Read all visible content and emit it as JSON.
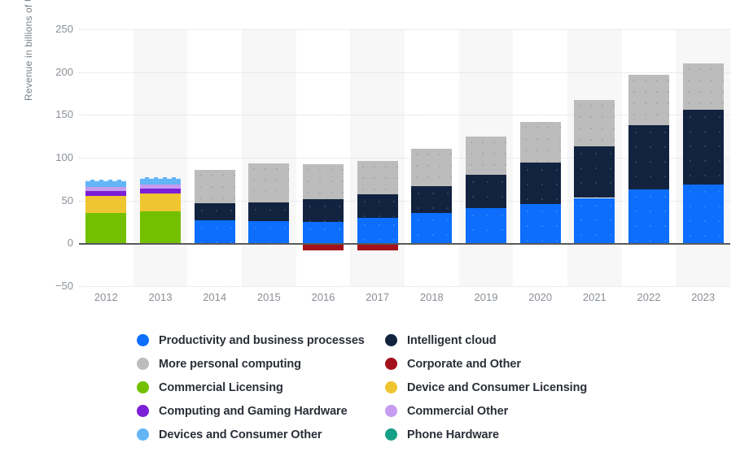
{
  "chart_data": {
    "type": "bar",
    "stacked": true,
    "title": "",
    "xlabel": "",
    "ylabel": "Revenue in billions of U.S. dollars",
    "categories": [
      "2012",
      "2013",
      "2014",
      "2015",
      "2016",
      "2017",
      "2018",
      "2019",
      "2020",
      "2021",
      "2022",
      "2023"
    ],
    "ylim": [
      -50,
      250
    ],
    "yticks": [
      -50,
      0,
      50,
      100,
      150,
      200,
      250
    ],
    "grid": true,
    "legend_position": "bottom",
    "series": [
      {
        "name": "Productivity and business processes",
        "color": "#0d6efd",
        "values": [
          null,
          null,
          27,
          26,
          25,
          30,
          35,
          41,
          46,
          53,
          63,
          69
        ]
      },
      {
        "name": "Intelligent cloud",
        "color": "#122340",
        "values": [
          null,
          null,
          20,
          22,
          27,
          27,
          32,
          39,
          48,
          60,
          75,
          87
        ]
      },
      {
        "name": "More personal computing",
        "color": "#bcbcbc",
        "values": [
          null,
          null,
          39,
          45,
          40,
          39,
          43,
          45,
          48,
          54,
          59,
          54
        ]
      },
      {
        "name": "Corporate and Other",
        "color": "#a5111a",
        "values": [
          null,
          null,
          null,
          null,
          -8,
          -8,
          null,
          null,
          null,
          null,
          null,
          null
        ]
      },
      {
        "name": "Commercial Licensing",
        "color": "#72c000",
        "values": [
          37,
          39,
          null,
          null,
          null,
          null,
          null,
          null,
          null,
          null,
          null,
          null
        ]
      },
      {
        "name": "Device and Consumer Licensing",
        "color": "#efc531",
        "values": [
          20,
          21,
          null,
          null,
          null,
          null,
          null,
          null,
          null,
          null,
          null,
          null
        ]
      },
      {
        "name": "Computing and Gaming Hardware",
        "color": "#7b1fd8",
        "values": [
          6,
          6,
          null,
          null,
          null,
          null,
          null,
          null,
          null,
          null,
          null,
          null
        ]
      },
      {
        "name": "Commercial Other",
        "color": "#c79bf0",
        "values": [
          5,
          5,
          null,
          null,
          null,
          null,
          null,
          null,
          null,
          null,
          null,
          null
        ]
      },
      {
        "name": "Devices and Consumer Other",
        "color": "#64b5f6",
        "values": [
          6,
          6,
          null,
          null,
          null,
          null,
          null,
          null,
          null,
          null,
          null,
          null
        ]
      },
      {
        "name": "Phone Hardware",
        "color": "#16a085",
        "values": [
          null,
          null,
          null,
          null,
          null,
          null,
          null,
          null,
          null,
          null,
          null,
          null
        ]
      }
    ],
    "totals": [
      74,
      77,
      86,
      93,
      92,
      96,
      110,
      125,
      142,
      167,
      197,
      210
    ]
  },
  "axis": {
    "y_title": "Revenue in billions of U.S. dollars",
    "y_ticks": [
      "250",
      "200",
      "150",
      "100",
      "50",
      "0",
      "−50"
    ],
    "x_ticks": [
      "2012",
      "2013",
      "2014",
      "2015",
      "2016",
      "2017",
      "2018",
      "2019",
      "2020",
      "2021",
      "2022",
      "2023"
    ]
  },
  "legend": {
    "left_column": [
      {
        "label": "Productivity and business processes",
        "color": "#0d6efd"
      },
      {
        "label": "More personal computing",
        "color": "#bcbcbc"
      },
      {
        "label": "Commercial Licensing",
        "color": "#72c000"
      },
      {
        "label": "Computing and Gaming Hardware",
        "color": "#7b1fd8"
      },
      {
        "label": "Devices and Consumer Other",
        "color": "#64b5f6"
      }
    ],
    "right_column": [
      {
        "label": "Intelligent cloud",
        "color": "#122340"
      },
      {
        "label": "Corporate and Other",
        "color": "#a5111a"
      },
      {
        "label": "Device and Consumer Licensing",
        "color": "#efc531"
      },
      {
        "label": "Commercial Other",
        "color": "#c79bf0"
      },
      {
        "label": "Phone Hardware",
        "color": "#16a085"
      }
    ]
  },
  "colors": {
    "background": "#ffffff",
    "band": "#f7f7f7",
    "gridline": "#dcdcdc",
    "zero_axis": "#58595b",
    "tick_text": "#8a9097",
    "legend_text": "#2b2f38"
  }
}
